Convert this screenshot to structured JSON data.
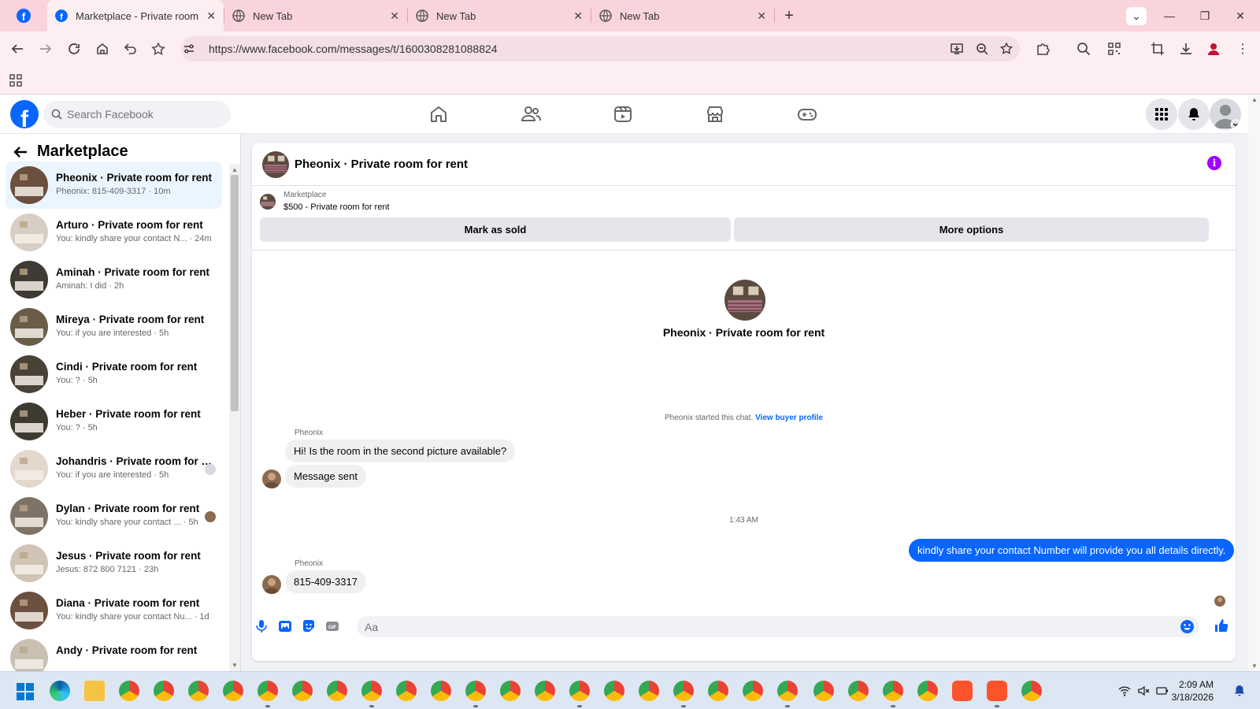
{
  "browser": {
    "tabs": [
      {
        "label": "Marketplace - Private room for",
        "active": true
      },
      {
        "label": "New Tab",
        "active": false
      },
      {
        "label": "New Tab",
        "active": false
      },
      {
        "label": "New Tab",
        "active": false
      }
    ],
    "url": "https://www.facebook.com/messages/t/1600308281088824"
  },
  "header": {
    "search_placeholder": "Search Facebook"
  },
  "sidebar": {
    "title": "Marketplace",
    "conversations": [
      {
        "name": "Pheonix · Private room for rent",
        "preview": "Pheonix: 815-409-3317 · 10m",
        "active": true
      },
      {
        "name": "Arturo · Private room for rent",
        "preview": "You: kindly share your contact N... · 24m"
      },
      {
        "name": "Aminah · Private room for rent",
        "preview": "Aminah: I did · 2h"
      },
      {
        "name": "Mireya · Private room for rent",
        "preview": "You: if you are interested · 5h"
      },
      {
        "name": "Cindi · Private room for rent",
        "preview": "You: ? · 5h"
      },
      {
        "name": "Heber · Private room for rent",
        "preview": "You: ? · 5h"
      },
      {
        "name": "Johandris · Private room for r...",
        "preview": "You: if you are interested · 5h"
      },
      {
        "name": "Dylan · Private room for rent",
        "preview": "You: kindly share your contact ... · 5h"
      },
      {
        "name": "Jesus · Private room for rent",
        "preview": "Jesus: 872 800 7121 · 23h"
      },
      {
        "name": "Diana · Private room for rent",
        "preview": "You: kindly share your contact Nu... · 1d"
      },
      {
        "name": "Andy · Private room for rent",
        "preview": ""
      }
    ]
  },
  "chat": {
    "title": "Pheonix · Private room for rent",
    "marketplace_label": "Marketplace",
    "listing": "$500 - Private room for rent",
    "mark_sold": "Mark as sold",
    "more_options": "More options",
    "intro_name": "Pheonix · Private room for rent",
    "started_text": "Pheonix started this chat.",
    "view_profile": "View buyer profile",
    "messages": [
      {
        "sender": "Pheonix",
        "text": "Hi! Is the room in the second picture available?"
      },
      {
        "text": "Message sent"
      },
      {
        "timestamp": "1:43 AM"
      },
      {
        "text": "kindly share your contact Number will provide you all details directly.",
        "outgoing": true
      },
      {
        "sender": "Pheonix",
        "text": "815-409-3317"
      }
    ],
    "composer_placeholder": "Aa"
  },
  "taskbar": {
    "time": "2:09 AM",
    "date": "3/18/2026"
  },
  "colors": {
    "fb_blue": "#0866ff",
    "tab_bar": "#fad4db",
    "info_purple": "#a100ff"
  }
}
